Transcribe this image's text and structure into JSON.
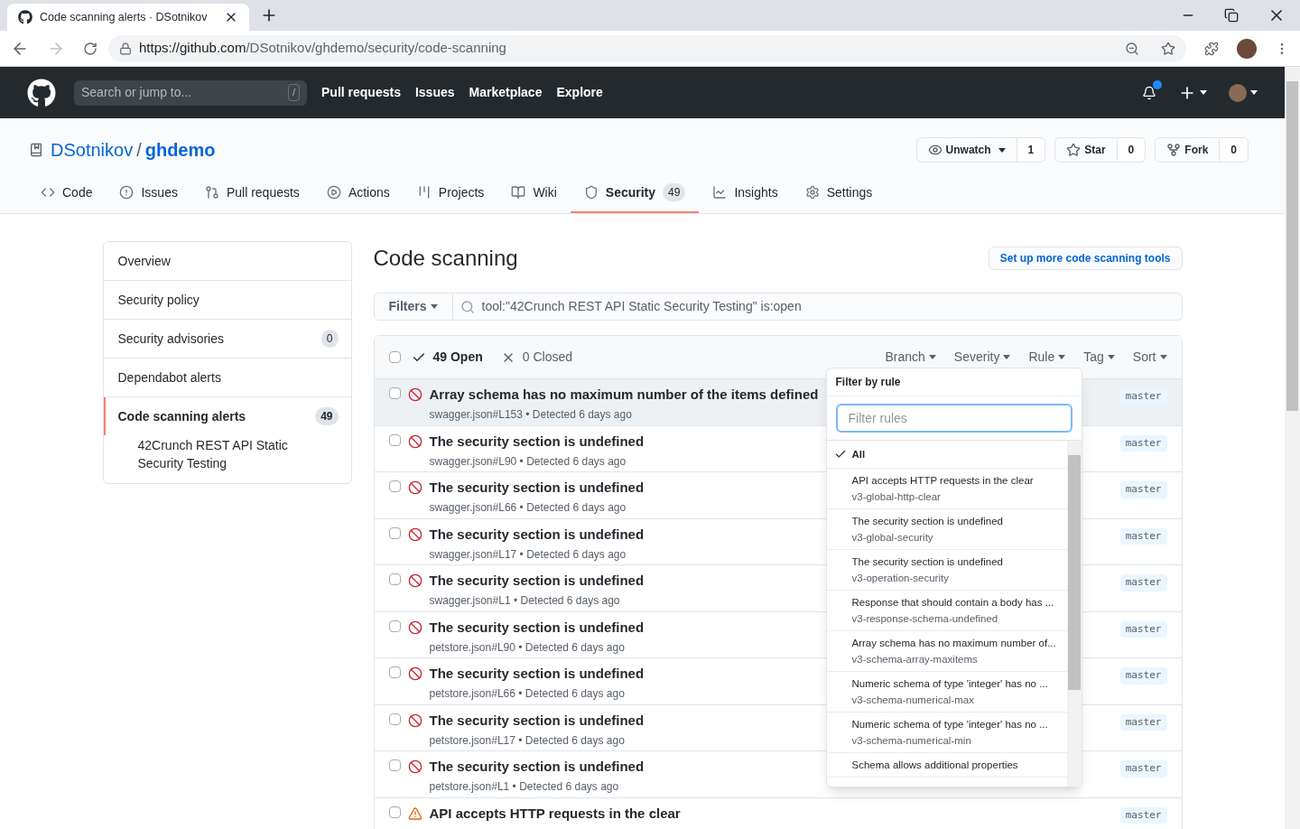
{
  "browser": {
    "tab_title": "Code scanning alerts · DSotnikov",
    "url_host": "https://github.com",
    "url_path": "/DSotnikov/ghdemo/security/code-scanning"
  },
  "header": {
    "search_placeholder": "Search or jump to...",
    "search_key": "/",
    "nav": [
      "Pull requests",
      "Issues",
      "Marketplace",
      "Explore"
    ],
    "notification_unread": true
  },
  "repo": {
    "owner": "DSotnikov",
    "separator": "/",
    "name": "ghdemo",
    "actions": [
      {
        "kind": "watch",
        "label": "Unwatch",
        "count": "1"
      },
      {
        "kind": "star",
        "label": "Star",
        "count": "0"
      },
      {
        "kind": "fork",
        "label": "Fork",
        "count": "0"
      }
    ]
  },
  "tabs": [
    {
      "kind": "code",
      "label": "Code",
      "selected": false
    },
    {
      "kind": "issues",
      "label": "Issues",
      "selected": false
    },
    {
      "kind": "pulls",
      "label": "Pull requests",
      "selected": false
    },
    {
      "kind": "actions",
      "label": "Actions",
      "selected": false
    },
    {
      "kind": "projects",
      "label": "Projects",
      "selected": false
    },
    {
      "kind": "wiki",
      "label": "Wiki",
      "selected": false
    },
    {
      "kind": "security",
      "label": "Security",
      "count": "49",
      "selected": true
    },
    {
      "kind": "insights",
      "label": "Insights",
      "selected": false
    },
    {
      "kind": "settings",
      "label": "Settings",
      "selected": false
    }
  ],
  "sidebar": {
    "items": [
      {
        "label": "Overview",
        "selected": false
      },
      {
        "label": "Security policy",
        "selected": false
      },
      {
        "label": "Security advisories",
        "count": "0",
        "selected": false
      },
      {
        "label": "Dependabot alerts",
        "selected": false
      },
      {
        "label": "Code scanning alerts",
        "count": "49",
        "selected": true,
        "children": [
          {
            "label": "42Crunch REST API Static Security Testing"
          }
        ]
      }
    ]
  },
  "page": {
    "title": "Code scanning",
    "setup_button": "Set up more code scanning tools",
    "filters_button": "Filters",
    "search_value": "tool:\"42Crunch REST API Static Security Testing\" is:open"
  },
  "list": {
    "select_all_checked": false,
    "states": [
      {
        "kind": "open",
        "label": "49 Open",
        "selected": true
      },
      {
        "kind": "closed",
        "label": "0 Closed",
        "selected": false
      }
    ],
    "filters": [
      "Branch",
      "Severity",
      "Rule",
      "Tag",
      "Sort"
    ],
    "alerts": [
      {
        "title": "Array schema has no maximum number of the items defined",
        "location": "swagger.json#L153",
        "separator": "•",
        "detected": "Detected 6 days ago",
        "kind": "error",
        "branch": "master",
        "hovered": true
      },
      {
        "title": "The security section is undefined",
        "location": "swagger.json#L90",
        "separator": "•",
        "detected": "Detected 6 days ago",
        "kind": "error",
        "branch": "master",
        "hovered": false
      },
      {
        "title": "The security section is undefined",
        "location": "swagger.json#L66",
        "separator": "•",
        "detected": "Detected 6 days ago",
        "kind": "error",
        "branch": "master",
        "hovered": false
      },
      {
        "title": "The security section is undefined",
        "location": "swagger.json#L17",
        "separator": "•",
        "detected": "Detected 6 days ago",
        "kind": "error",
        "branch": "master",
        "hovered": false
      },
      {
        "title": "The security section is undefined",
        "location": "swagger.json#L1",
        "separator": "•",
        "detected": "Detected 6 days ago",
        "kind": "error",
        "branch": "master",
        "hovered": false
      },
      {
        "title": "The security section is undefined",
        "location": "petstore.json#L90",
        "separator": "•",
        "detected": "Detected 6 days ago",
        "kind": "error",
        "branch": "master",
        "hovered": false
      },
      {
        "title": "The security section is undefined",
        "location": "petstore.json#L66",
        "separator": "•",
        "detected": "Detected 6 days ago",
        "kind": "error",
        "branch": "master",
        "hovered": false
      },
      {
        "title": "The security section is undefined",
        "location": "petstore.json#L17",
        "separator": "•",
        "detected": "Detected 6 days ago",
        "kind": "error",
        "branch": "master",
        "hovered": false
      },
      {
        "title": "The security section is undefined",
        "location": "petstore.json#L1",
        "separator": "•",
        "detected": "Detected 6 days ago",
        "kind": "error",
        "branch": "master",
        "hovered": false
      },
      {
        "title": "API accepts HTTP requests in the clear",
        "kind": "warning",
        "branch": "master",
        "hovered": false
      }
    ]
  },
  "rule_menu": {
    "title": "Filter by rule",
    "placeholder": "Filter rules",
    "items": [
      {
        "title": "All",
        "selected": true
      },
      {
        "title": "API accepts HTTP requests in the clear",
        "rule": "v3-global-http-clear",
        "selected": false
      },
      {
        "title": "The security section is undefined",
        "rule": "v3-global-security",
        "selected": false
      },
      {
        "title": "The security section is undefined",
        "rule": "v3-operation-security",
        "selected": false
      },
      {
        "title": "Response that should contain a body has ...",
        "rule": "v3-response-schema-undefined",
        "selected": false
      },
      {
        "title": "Array schema has no maximum number of...",
        "rule": "v3-schema-array-maxitems",
        "selected": false
      },
      {
        "title": "Numeric schema of type 'integer' has no ...",
        "rule": "v3-schema-numerical-max",
        "selected": false
      },
      {
        "title": "Numeric schema of type 'integer' has no ...",
        "rule": "v3-schema-numerical-min",
        "selected": false
      },
      {
        "title": "Schema allows additional properties",
        "selected": false
      }
    ]
  }
}
